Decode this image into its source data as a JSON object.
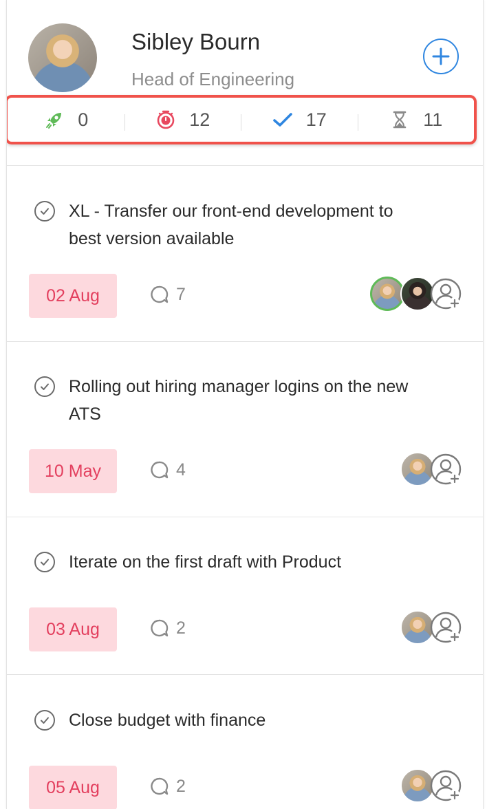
{
  "profile": {
    "name": "Sibley Bourn",
    "role": "Head of Engineering"
  },
  "stats": [
    {
      "icon": "rocket-icon",
      "value": "0",
      "color": "#5fba58"
    },
    {
      "icon": "timer-icon",
      "value": "12",
      "color": "#e8485f"
    },
    {
      "icon": "checkmark-icon",
      "value": "17",
      "color": "#2f86e0"
    },
    {
      "icon": "hourglass-icon",
      "value": "11",
      "color": "#8a8a8a"
    }
  ],
  "tasks": [
    {
      "title": "XL - Transfer our front-end development to best version available",
      "date": "02 Aug",
      "comments": "7"
    },
    {
      "title": "Rolling out hiring manager logins on the new ATS",
      "date": "10 May",
      "comments": "4"
    },
    {
      "title": "Iterate on the first draft with Product",
      "date": "03 Aug",
      "comments": "2"
    },
    {
      "title": "Close budget with finance",
      "date": "05 Aug",
      "comments": "2"
    }
  ],
  "colors": {
    "accent": "#2f86e0",
    "highlight_border": "#f0524b",
    "date_bg": "#fdd9de",
    "date_text": "#e33f5e"
  }
}
